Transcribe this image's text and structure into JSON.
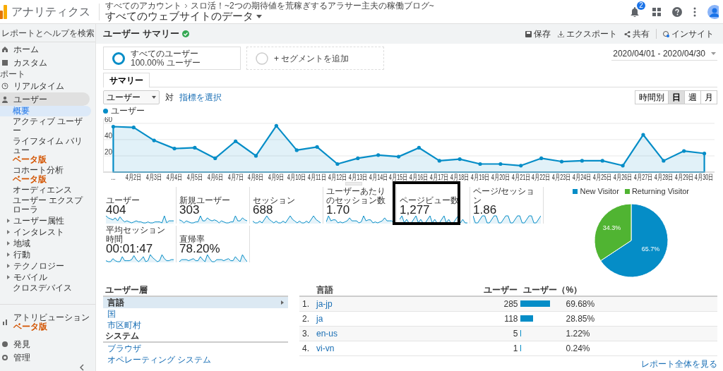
{
  "header": {
    "app_name": "アナリティクス",
    "breadcrumb": [
      "すべてのアカウント",
      "スロ活！~2つの期待値を荒稼ぎするアラサー主夫の稼働ブログ~"
    ],
    "property": "すべてのウェブサイトのデータ",
    "notification_count": "2"
  },
  "sidebar": {
    "search_placeholder": "レポートとヘルプを検索",
    "items": [
      {
        "kind": "item",
        "label": "ホーム",
        "selected": false
      },
      {
        "kind": "item",
        "label": "カスタム",
        "selected": false
      },
      {
        "kind": "section",
        "label": "ポート"
      },
      {
        "kind": "item",
        "label": "リアルタイム",
        "selected": false
      },
      {
        "kind": "item",
        "label": "ユーザー",
        "selected": true,
        "expanded": true,
        "children": [
          {
            "kind": "link",
            "label": "概要",
            "selected": true
          },
          {
            "kind": "link",
            "label": "アクティブ ユーザー",
            "selected": false
          },
          {
            "kind": "link",
            "label": "ライフタイム バリュー",
            "badge": "ベータ版",
            "selected": false
          },
          {
            "kind": "link",
            "label": "コホート分析",
            "badge": "ベータ版",
            "selected": false
          },
          {
            "kind": "link",
            "label": "オーディエンス",
            "selected": false
          },
          {
            "kind": "link",
            "label": "ユーザー エクスプローラ",
            "selected": false
          },
          {
            "kind": "group",
            "label": "ユーザー属性",
            "expanded": false,
            "selected": false
          },
          {
            "kind": "group",
            "label": "インタレスト",
            "expanded": false,
            "selected": false
          },
          {
            "kind": "group",
            "label": "地域",
            "expanded": false,
            "selected": false
          },
          {
            "kind": "group",
            "label": "行動",
            "expanded": false,
            "selected": false
          },
          {
            "kind": "group",
            "label": "テクノロジー",
            "expanded": false,
            "selected": false
          },
          {
            "kind": "group",
            "label": "モバイル",
            "expanded": false,
            "selected": false
          },
          {
            "kind": "link",
            "label": "クロスデバイス",
            "selected": false
          }
        ]
      }
    ],
    "footer_items": [
      {
        "label": "アトリビューション",
        "badge": "ベータ版",
        "selected": false
      },
      {
        "label": "発見",
        "selected": false
      },
      {
        "label": "管理",
        "selected": false
      }
    ]
  },
  "toolbar": {
    "title": "ユーザー サマリー",
    "actions": [
      "保存",
      "エクスポート",
      "共有",
      "インサイト"
    ]
  },
  "segments": [
    {
      "kind": "segment",
      "name": "すべてのユーザー",
      "detail": "100.00% ユーザー"
    },
    {
      "kind": "add",
      "name": "+ セグメントを追加"
    }
  ],
  "date_range": "2020/04/01 - 2020/04/30",
  "tabs": [
    {
      "label": "サマリー",
      "selected": true
    }
  ],
  "chart_controls": {
    "metric": "ユーザー",
    "versus": "対",
    "choose_link": "指標を選択",
    "granularity": [
      {
        "label": "時間別",
        "selected": false
      },
      {
        "label": "日",
        "selected": true
      },
      {
        "label": "週",
        "selected": false
      },
      {
        "label": "月",
        "selected": false
      }
    ]
  },
  "trend": {
    "chart_data": {
      "type": "area",
      "categories": [
        "...",
        "4月2日",
        "4月3日",
        "4月4日",
        "4月5日",
        "4月6日",
        "4月7日",
        "4月8日",
        "4月9日",
        "4月10日",
        "4月11日",
        "4月12日",
        "4月13日",
        "4月14日",
        "4月15日",
        "4月16日",
        "4月17日",
        "4月18日",
        "4月19日",
        "4月20日",
        "4月21日",
        "4月22日",
        "4月23日",
        "4月24日",
        "4月25日",
        "4月26日",
        "4月27日",
        "4月28日",
        "4月29日",
        "4月30日"
      ],
      "series": [
        {
          "name": "ユーザー",
          "color": "#058dc7",
          "values": [
            56,
            55,
            39,
            29,
            30,
            17,
            38,
            20,
            57,
            27,
            31,
            10,
            17,
            21,
            19,
            30,
            14,
            16,
            10,
            10,
            8,
            17,
            13,
            14,
            14,
            8,
            46,
            14,
            26,
            23
          ]
        }
      ],
      "ylim": [
        0,
        66
      ],
      "yticks": [
        20,
        40,
        60
      ],
      "grid": true
    }
  },
  "metrics": [
    {
      "label": "ユーザー",
      "value": "404",
      "highlighted": false
    },
    {
      "label": "新規ユーザー",
      "value": "303",
      "highlighted": false
    },
    {
      "label": "セッション",
      "value": "688",
      "highlighted": false
    },
    {
      "label": "ユーザーあたりのセッション数",
      "value": "1.70",
      "highlighted": false
    },
    {
      "label": "ページビュー数",
      "value": "1,277",
      "highlighted": true
    },
    {
      "label": "ページ/セッション",
      "value": "1.86",
      "highlighted": false
    },
    {
      "label": "平均セッション時間",
      "value": "00:01:47",
      "highlighted": false
    },
    {
      "label": "直帰率",
      "value": "78.20%",
      "highlighted": false
    }
  ],
  "visitor_pie": {
    "chart_data": {
      "type": "pie",
      "categories": [
        "New Visitor",
        "Returning Visitor"
      ],
      "values": [
        65.7,
        34.3
      ],
      "colors": [
        "#058dc7",
        "#50b432"
      ],
      "value_labels": [
        "65.7%",
        "34.3%"
      ],
      "legend": "top"
    }
  },
  "demographics": [
    {
      "title": "ユーザー層",
      "items": [
        {
          "label": "言語",
          "selected": true
        },
        {
          "label": "国",
          "selected": false
        },
        {
          "label": "市区町村",
          "selected": false
        }
      ]
    },
    {
      "title": "システム",
      "items": [
        {
          "label": "ブラウザ",
          "selected": false
        },
        {
          "label": "オペレーティング システム",
          "selected": false
        }
      ]
    }
  ],
  "language_table": {
    "columns": [
      "言語",
      "ユーザー",
      "ユーザー（%）"
    ],
    "rows": [
      {
        "rank": "1.",
        "language": "ja-jp",
        "users": "285",
        "percent": "69.68%",
        "level": 0.6968
      },
      {
        "rank": "2.",
        "language": "ja",
        "users": "118",
        "percent": "28.85%",
        "level": 0.2885
      },
      {
        "rank": "3.",
        "language": "en-us",
        "users": "5",
        "percent": "1.22%",
        "level": 0.0122
      },
      {
        "rank": "4.",
        "language": "vi-vn",
        "users": "1",
        "percent": "0.24%",
        "level": 0.0024
      }
    ],
    "footer_link": "レポート全体を見る"
  }
}
